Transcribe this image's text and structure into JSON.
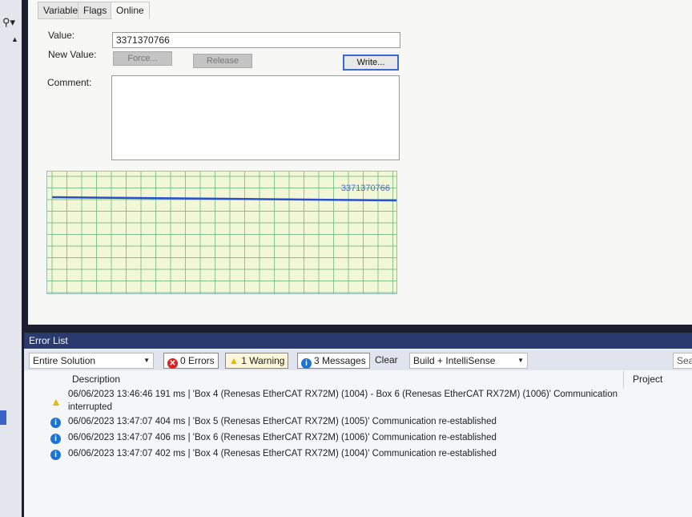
{
  "tabs": [
    "Variable",
    "Flags",
    "Online"
  ],
  "online": {
    "value_label": "Value:",
    "value": "3371370766",
    "new_value_label": "New Value:",
    "force": "Force...",
    "release": "Release",
    "write": "Write...",
    "comment_label": "Comment:",
    "comment": "",
    "chart_label": "3371370766"
  },
  "error_list": {
    "title": "Error List",
    "scope": "Entire Solution",
    "errors": "0 Errors",
    "warnings": "1 Warning",
    "messages": "3 Messages",
    "clear": "Clear",
    "filter": "Build + IntelliSense",
    "search": "Sear",
    "col_description": "Description",
    "col_project": "Project",
    "rows": [
      {
        "type": "warning",
        "line1": "06/06/2023 13:46:46 191 ms | 'Box 4 (Renesas EtherCAT RX72M) (1004) - Box 6 (Renesas EtherCAT RX72M) (1006)' Communication",
        "line2": "interrupted"
      },
      {
        "type": "info",
        "line1": "06/06/2023 13:47:07 404 ms | 'Box 5 (Renesas EtherCAT RX72M) (1005)' Communication re-established"
      },
      {
        "type": "info",
        "line1": "06/06/2023 13:47:07 406 ms | 'Box 6 (Renesas EtherCAT RX72M) (1006)' Communication re-established"
      },
      {
        "type": "info",
        "line1": "06/06/2023 13:47:07 402 ms | 'Box 4 (Renesas EtherCAT RX72M) (1004)' Communication re-established"
      }
    ]
  },
  "colors": {
    "accent": "#3a6ad0",
    "chart_line": "#2a4fd0",
    "grid": "#5fb07a",
    "header": "#2b3a6e"
  }
}
